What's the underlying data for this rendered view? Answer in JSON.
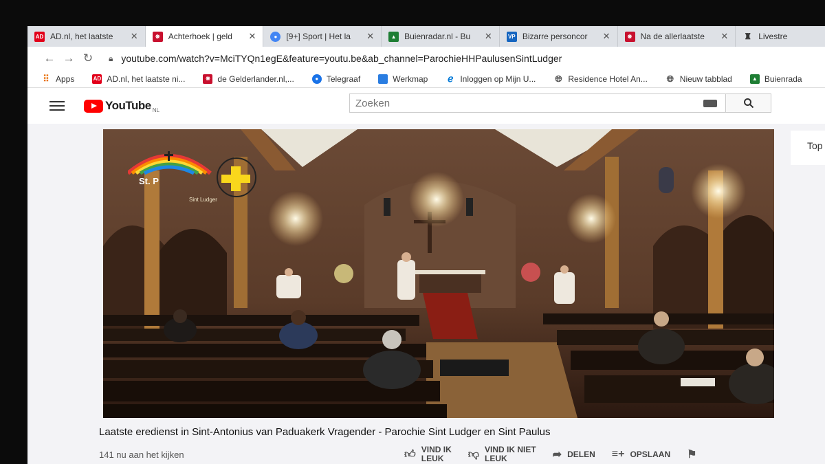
{
  "tabs": [
    {
      "title": "AD.nl, het laatste",
      "favicon": "ad-logo-icon",
      "color": "#e2001a",
      "mark": "AD",
      "active": false
    },
    {
      "title": "Achterhoek | geld",
      "favicon": "gelderlander-icon",
      "color": "#c8102e",
      "mark": "",
      "active": true
    },
    {
      "title": "[9+] Sport | Het la",
      "favicon": "chrome-icon",
      "color": "#4285f4",
      "mark": "",
      "active": false
    },
    {
      "title": "Buienradar.nl - Bu",
      "favicon": "buienradar-icon",
      "color": "#1e7e34",
      "mark": "",
      "active": false
    },
    {
      "title": "Bizarre personcor",
      "favicon": "vp-icon",
      "color": "#1565c0",
      "mark": "VP",
      "active": false
    },
    {
      "title": "Na de allerlaatste",
      "favicon": "gelderlander-icon",
      "color": "#c8102e",
      "mark": "",
      "active": false
    },
    {
      "title": "Livestre",
      "favicon": "candle-icon",
      "color": "#333333",
      "mark": "",
      "active": false
    }
  ],
  "address": {
    "url": "youtube.com/watch?v=MciTYQn1egE&feature=youtu.be&ab_channel=ParochieHHPaulusenSintLudger"
  },
  "bookmarks": [
    {
      "label": "Apps",
      "favicon": "apps-grid-icon",
      "color": "#e8710a"
    },
    {
      "label": "AD.nl, het laatste ni...",
      "favicon": "ad-logo-icon",
      "color": "#e2001a"
    },
    {
      "label": "de Gelderlander.nl,...",
      "favicon": "gelderlander-icon",
      "color": "#c8102e"
    },
    {
      "label": "Telegraaf",
      "favicon": "telegraaf-icon",
      "color": "#1a73e8"
    },
    {
      "label": "Werkmap",
      "favicon": "werkmap-icon",
      "color": "#2a7de1"
    },
    {
      "label": "Inloggen op Mijn U...",
      "favicon": "edge-icon",
      "color": "#0078d7"
    },
    {
      "label": "Residence Hotel An...",
      "favicon": "globe-icon",
      "color": "#555555"
    },
    {
      "label": "Nieuw tabblad",
      "favicon": "globe-icon",
      "color": "#555555"
    },
    {
      "label": "Buienrada",
      "favicon": "buienradar-icon",
      "color": "#1e7e34"
    }
  ],
  "youtube": {
    "logo_text": "YouTube",
    "region": "NL",
    "search_placeholder": "Zoeken",
    "sidebar_top": "Top"
  },
  "video": {
    "title": "Laatste eredienst in Sint-Antonius van Paduakerk Vragender - Parochie Sint Ludger en Sint Paulus",
    "viewers": "141 nu aan het kijken",
    "overlay_logo_text": "St. P",
    "overlay_logo_sub": "Sint Ludger"
  },
  "actions": [
    {
      "label_line1": "VIND IK",
      "label_line2": "LEUK",
      "icon": "thumbs-up-icon"
    },
    {
      "label_line1": "VIND IK NIET",
      "label_line2": "LEUK",
      "icon": "thumbs-down-icon"
    },
    {
      "label_line1": "DELEN",
      "label_line2": "",
      "icon": "share-icon"
    },
    {
      "label_line1": "OPSLAAN",
      "label_line2": "",
      "icon": "playlist-add-icon"
    },
    {
      "label_line1": "",
      "label_line2": "",
      "icon": "flag-icon"
    }
  ]
}
